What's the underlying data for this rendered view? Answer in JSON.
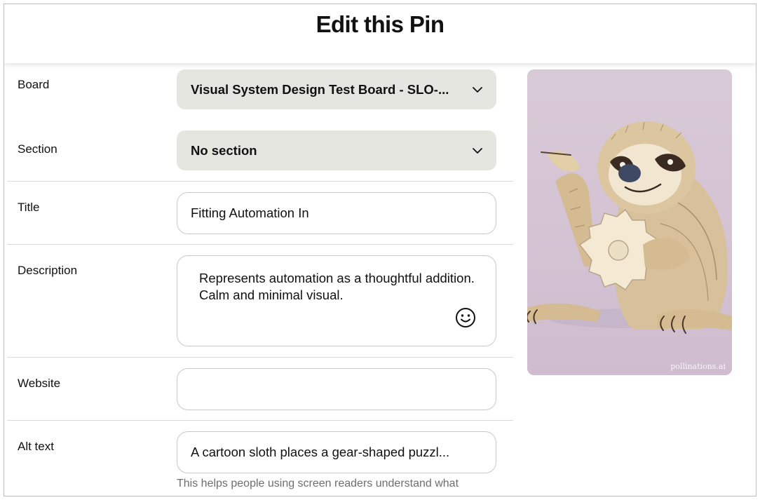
{
  "header": {
    "title": "Edit this Pin"
  },
  "form": {
    "board": {
      "label": "Board",
      "value": "Visual System Design Test Board - SLO-..."
    },
    "section": {
      "label": "Section",
      "value": "No section"
    },
    "title": {
      "label": "Title",
      "value": "Fitting Automation In"
    },
    "description": {
      "label": "Description",
      "value": "Represents automation as a thoughtful addition. Calm and minimal visual."
    },
    "website": {
      "label": "Website",
      "value": ""
    },
    "alt_text": {
      "label": "Alt text",
      "value": "A cartoon sloth places a gear-shaped puzzl...",
      "hint": "This helps people using screen readers understand what"
    }
  },
  "preview": {
    "watermark": "pollinations.ai",
    "background_color": "#d6c6d4"
  },
  "icons": {
    "dropdown": "chevron-down-icon",
    "emoji": "smiley-face-icon"
  }
}
